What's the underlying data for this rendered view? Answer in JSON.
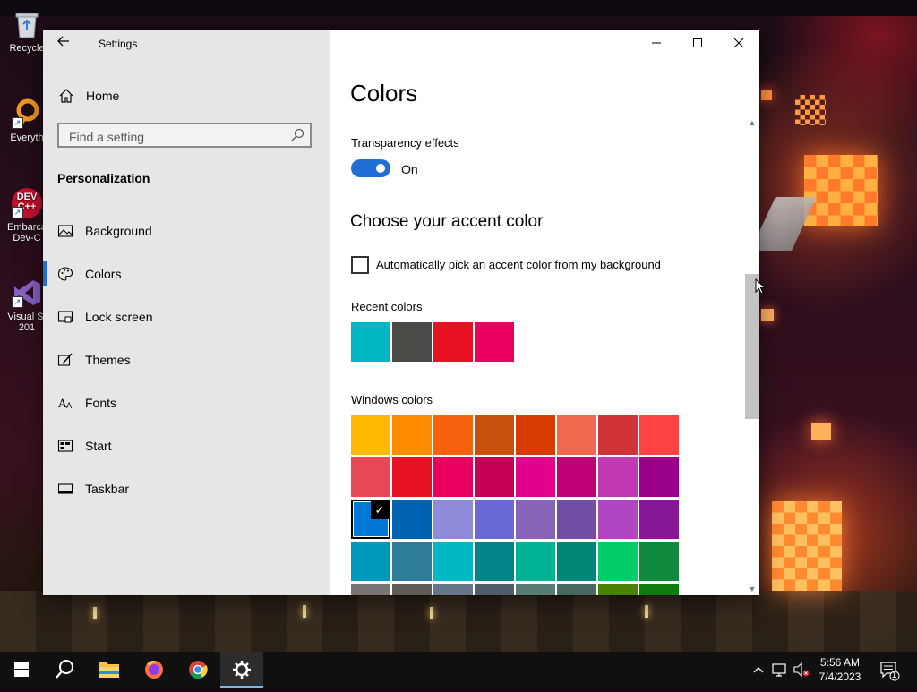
{
  "desktop": {
    "icons": [
      {
        "label": "Recycle"
      },
      {
        "label": "Everyth"
      },
      {
        "label": "Embarca Dev-C"
      },
      {
        "label": "Visual St 201"
      }
    ]
  },
  "window": {
    "title": "Settings",
    "controls": {
      "minimize": "—",
      "maximize": "☐",
      "close": "✕"
    }
  },
  "sidebar": {
    "home_label": "Home",
    "search_placeholder": "Find a setting",
    "section": "Personalization",
    "items": [
      {
        "label": "Background",
        "icon": "picture-icon"
      },
      {
        "label": "Colors",
        "icon": "palette-icon",
        "active": true
      },
      {
        "label": "Lock screen",
        "icon": "lock-screen-icon"
      },
      {
        "label": "Themes",
        "icon": "brush-icon"
      },
      {
        "label": "Fonts",
        "icon": "font-icon"
      },
      {
        "label": "Start",
        "icon": "start-icon"
      },
      {
        "label": "Taskbar",
        "icon": "taskbar-icon"
      }
    ]
  },
  "main": {
    "title": "Colors",
    "transparency_label": "Transparency effects",
    "transparency_state": "On",
    "accent_heading": "Choose your accent color",
    "auto_pick_label": "Automatically pick an accent color from my background",
    "recent_label": "Recent colors",
    "recent_colors": [
      "#00b7c3",
      "#4c4a48",
      "#e81123",
      "#ea005e"
    ],
    "windows_label": "Windows colors",
    "windows_colors": [
      "#ffb900",
      "#ff8c00",
      "#f7630c",
      "#ca5010",
      "#da3b01",
      "#ef6950",
      "#d13438",
      "#ff4343",
      "#e74856",
      "#e81123",
      "#ea005e",
      "#c30052",
      "#e3008c",
      "#bf0077",
      "#c239b3",
      "#9a0089",
      "#0078d7",
      "#0063b1",
      "#8e8cd8",
      "#6b69d6",
      "#8764b8",
      "#744da9",
      "#b146c2",
      "#881798",
      "#0099bc",
      "#2d7d9a",
      "#00b7c3",
      "#038387",
      "#00b294",
      "#018574",
      "#00cc6a",
      "#10893e",
      "#7a7574",
      "#5d5a58",
      "#68768a",
      "#515c6b",
      "#567c73",
      "#486860",
      "#498205",
      "#107c10"
    ],
    "selected_color": "#0078d7",
    "accent": "#1f6fd6"
  },
  "taskbar": {
    "time": "5:56 AM",
    "date": "7/4/2023",
    "notification_count": "1"
  }
}
